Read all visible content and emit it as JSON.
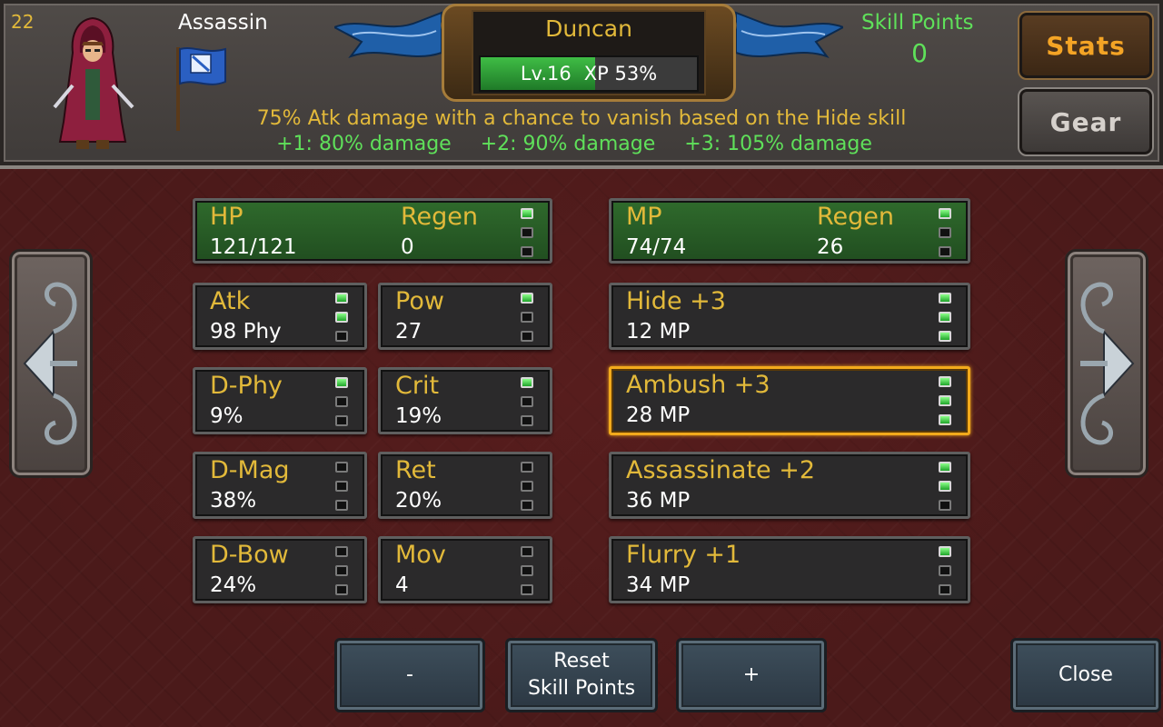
{
  "header": {
    "level_number": "22",
    "class_name": "Assassin",
    "character_name": "Duncan",
    "level_label": "Lv.16",
    "xp_label": "XP 53%",
    "xp_fraction": 0.53,
    "skill_points_label": "Skill Points",
    "skill_points_value": "0",
    "description": "75% Atk damage with a chance to vanish based on the Hide skill",
    "upgrades": [
      "+1: 80% damage",
      "+2: 90% damage",
      "+3: 105% damage"
    ]
  },
  "tabs": {
    "stats": "Stats",
    "gear": "Gear"
  },
  "stats": {
    "hp": {
      "label": "HP",
      "value": "121/121",
      "regen_label": "Regen",
      "regen_value": "0",
      "pips": [
        1,
        0,
        0
      ]
    },
    "mp": {
      "label": "MP",
      "value": "74/74",
      "regen_label": "Regen",
      "regen_value": "26",
      "pips": [
        1,
        0,
        0
      ]
    },
    "atk": {
      "label": "Atk",
      "value": "98 Phy",
      "pips": [
        1,
        1,
        0
      ]
    },
    "pow": {
      "label": "Pow",
      "value": "27",
      "pips": [
        1,
        0,
        0
      ]
    },
    "dphy": {
      "label": "D-Phy",
      "value": "9%",
      "pips": [
        1,
        0,
        0
      ]
    },
    "crit": {
      "label": "Crit",
      "value": "19%",
      "pips": [
        1,
        0,
        0
      ]
    },
    "dmag": {
      "label": "D-Mag",
      "value": "38%",
      "pips": [
        0,
        0,
        0
      ]
    },
    "ret": {
      "label": "Ret",
      "value": "20%",
      "pips": [
        0,
        0,
        0
      ]
    },
    "dbow": {
      "label": "D-Bow",
      "value": "24%",
      "pips": [
        0,
        0,
        0
      ]
    },
    "mov": {
      "label": "Mov",
      "value": "4",
      "pips": [
        0,
        0,
        0
      ]
    }
  },
  "skills": [
    {
      "label": "Hide +3",
      "cost": "12 MP",
      "pips": [
        1,
        1,
        1
      ]
    },
    {
      "label": "Ambush +3",
      "cost": "28 MP",
      "pips": [
        1,
        1,
        1
      ]
    },
    {
      "label": "Assassinate +2",
      "cost": "36 MP",
      "pips": [
        1,
        1,
        0
      ]
    },
    {
      "label": "Flurry +1",
      "cost": "34 MP",
      "pips": [
        1,
        0,
        0
      ]
    }
  ],
  "buttons": {
    "minus": "-",
    "reset_line1": "Reset",
    "reset_line2": "Skill Points",
    "plus": "+",
    "close": "Close"
  },
  "colors": {
    "accent_gold": "#e2b93a",
    "skill_green": "#5fe05a",
    "stats_tab": "#f4a425",
    "selected_border": "#f2aa1c"
  }
}
